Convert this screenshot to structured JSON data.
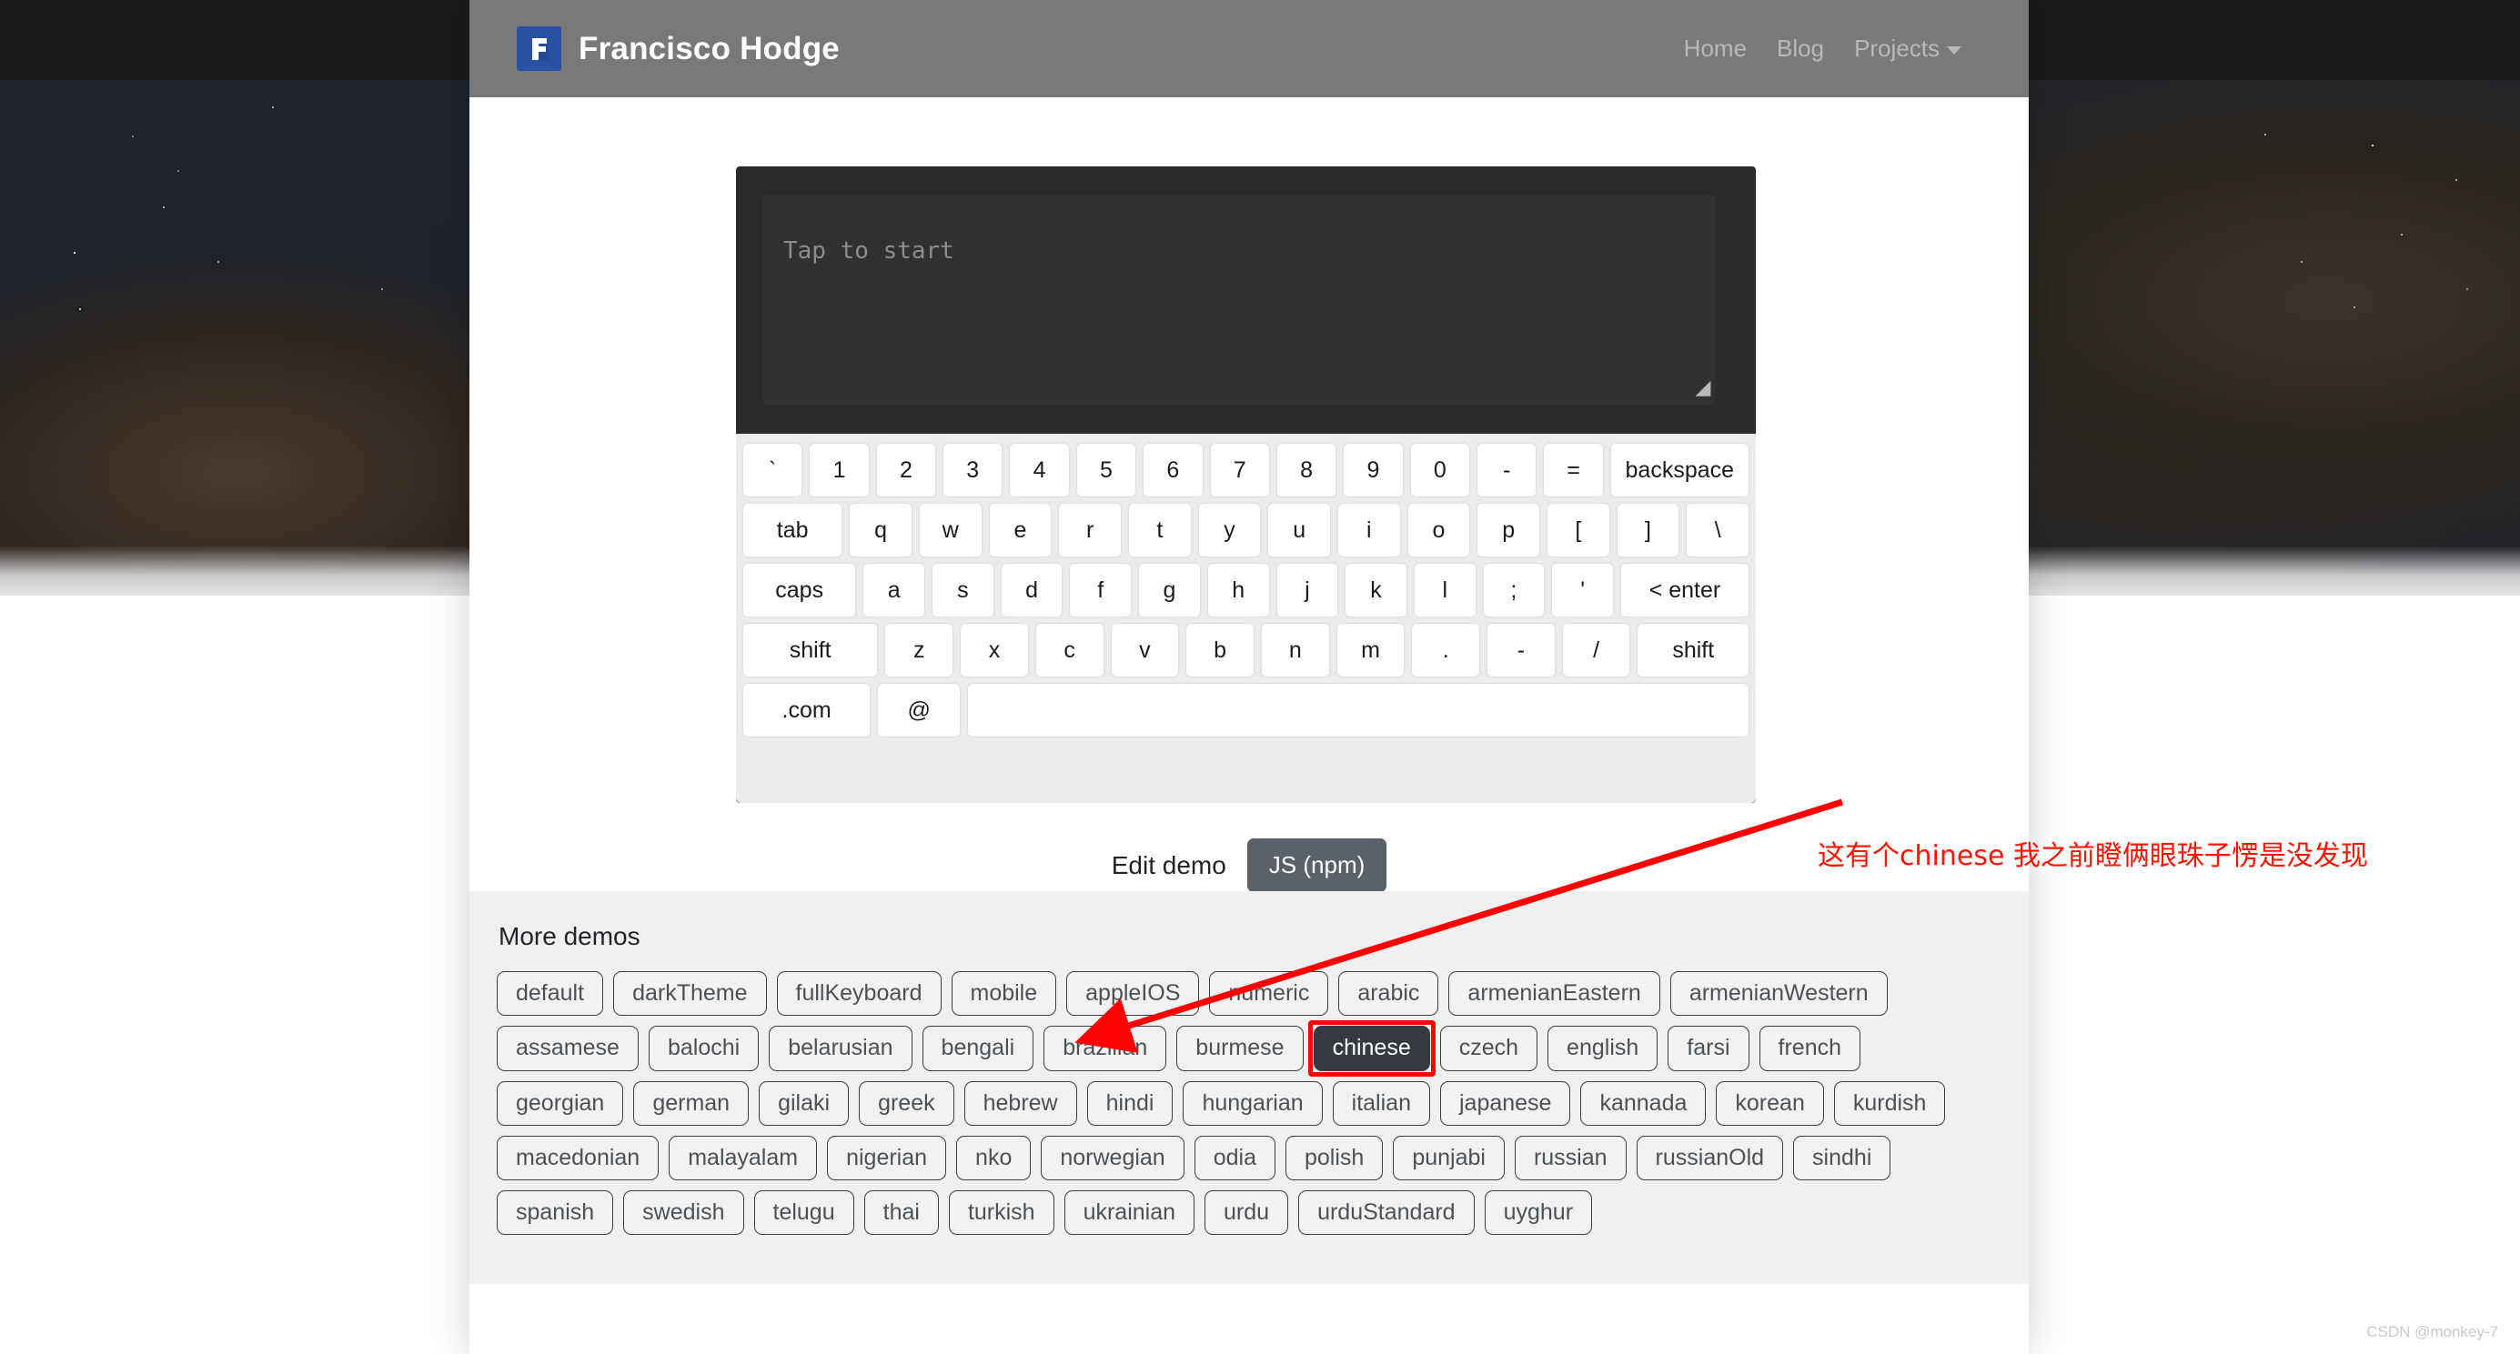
{
  "navbar": {
    "brand": "Francisco Hodge",
    "logo_icon": "f-logo-icon",
    "links": [
      {
        "label": "Home",
        "has_caret": false
      },
      {
        "label": "Blog",
        "has_caret": false
      },
      {
        "label": "Projects",
        "has_caret": true
      }
    ]
  },
  "demo": {
    "input_placeholder": "Tap to start",
    "input_value": "",
    "resize_handle_glyph": "◢",
    "keyboard_rows": [
      [
        {
          "label": "`",
          "width": "normal"
        },
        {
          "label": "1",
          "width": "normal"
        },
        {
          "label": "2",
          "width": "normal"
        },
        {
          "label": "3",
          "width": "normal"
        },
        {
          "label": "4",
          "width": "normal"
        },
        {
          "label": "5",
          "width": "normal"
        },
        {
          "label": "6",
          "width": "normal"
        },
        {
          "label": "7",
          "width": "normal"
        },
        {
          "label": "8",
          "width": "normal"
        },
        {
          "label": "9",
          "width": "normal"
        },
        {
          "label": "0",
          "width": "normal"
        },
        {
          "label": "-",
          "width": "normal"
        },
        {
          "label": "=",
          "width": "normal"
        },
        {
          "label": "backspace",
          "width": "w-backspace"
        }
      ],
      [
        {
          "label": "tab",
          "width": "w-tab"
        },
        {
          "label": "q",
          "width": "normal"
        },
        {
          "label": "w",
          "width": "normal"
        },
        {
          "label": "e",
          "width": "normal"
        },
        {
          "label": "r",
          "width": "normal"
        },
        {
          "label": "t",
          "width": "normal"
        },
        {
          "label": "y",
          "width": "normal"
        },
        {
          "label": "u",
          "width": "normal"
        },
        {
          "label": "i",
          "width": "normal"
        },
        {
          "label": "o",
          "width": "normal"
        },
        {
          "label": "p",
          "width": "normal"
        },
        {
          "label": "[",
          "width": "normal"
        },
        {
          "label": "]",
          "width": "normal"
        },
        {
          "label": "\\",
          "width": "normal"
        }
      ],
      [
        {
          "label": "caps",
          "width": "w-caps"
        },
        {
          "label": "a",
          "width": "normal"
        },
        {
          "label": "s",
          "width": "normal"
        },
        {
          "label": "d",
          "width": "normal"
        },
        {
          "label": "f",
          "width": "normal"
        },
        {
          "label": "g",
          "width": "normal"
        },
        {
          "label": "h",
          "width": "normal"
        },
        {
          "label": "j",
          "width": "normal"
        },
        {
          "label": "k",
          "width": "normal"
        },
        {
          "label": "l",
          "width": "normal"
        },
        {
          "label": ";",
          "width": "normal"
        },
        {
          "label": "'",
          "width": "normal"
        },
        {
          "label": "< enter",
          "width": "w-enter"
        }
      ],
      [
        {
          "label": "shift",
          "width": "w-shift-l"
        },
        {
          "label": "z",
          "width": "normal"
        },
        {
          "label": "x",
          "width": "normal"
        },
        {
          "label": "c",
          "width": "normal"
        },
        {
          "label": "v",
          "width": "normal"
        },
        {
          "label": "b",
          "width": "normal"
        },
        {
          "label": "n",
          "width": "normal"
        },
        {
          "label": "m",
          "width": "normal"
        },
        {
          "label": ".",
          "width": "normal"
        },
        {
          "label": "-",
          "width": "normal"
        },
        {
          "label": "/",
          "width": "normal"
        },
        {
          "label": "shift",
          "width": "w-shift-r"
        }
      ],
      [
        {
          "label": ".com",
          "width": "w-com"
        },
        {
          "label": "@",
          "width": "w-at"
        },
        {
          "label": "",
          "width": "w-space"
        }
      ]
    ],
    "edit_demo_label": "Edit demo",
    "js_npm_label": "JS (npm)"
  },
  "more_demos": {
    "title": "More demos",
    "active": "chinese",
    "buttons": [
      "default",
      "darkTheme",
      "fullKeyboard",
      "mobile",
      "appleIOS",
      "numeric",
      "arabic",
      "armenianEastern",
      "armenianWestern",
      "assamese",
      "balochi",
      "belarusian",
      "bengali",
      "brazilian",
      "burmese",
      "chinese",
      "czech",
      "english",
      "farsi",
      "french",
      "georgian",
      "german",
      "gilaki",
      "greek",
      "hebrew",
      "hindi",
      "hungarian",
      "italian",
      "japanese",
      "kannada",
      "korean",
      "kurdish",
      "macedonian",
      "malayalam",
      "nigerian",
      "nko",
      "norwegian",
      "odia",
      "polish",
      "punjabi",
      "russian",
      "russianOld",
      "sindhi",
      "spanish",
      "swedish",
      "telugu",
      "thai",
      "turkish",
      "ukrainian",
      "urdu",
      "urduStandard",
      "uyghur"
    ]
  },
  "annotation": {
    "text": "这有个chinese 我之前瞪俩眼珠子愣是没发现",
    "color": "#ff1200",
    "highlight_target": "chinese"
  },
  "watermark": {
    "text": "CSDN @monkey-7"
  }
}
